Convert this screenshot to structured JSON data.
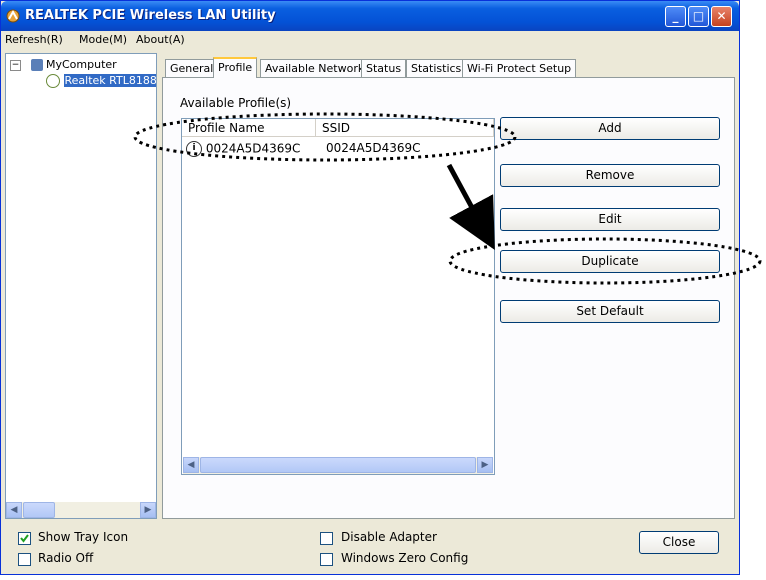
{
  "window": {
    "title": "REALTEK PCIE Wireless LAN Utility",
    "minimize_glyph": "_",
    "maximize_glyph": "□",
    "close_glyph": "✕"
  },
  "menu": {
    "refresh": "Refresh(R)",
    "mode": "Mode(M)",
    "about": "About(A)"
  },
  "tree": {
    "root": "MyComputer",
    "adapter": "Realtek RTL8188"
  },
  "tabs": [
    "General",
    "Profile",
    "Available Network",
    "Status",
    "Statistics",
    "Wi-Fi Protect Setup"
  ],
  "active_tab": "Profile",
  "profile": {
    "list_label": "Available Profile(s)",
    "columns": [
      "Profile Name",
      "SSID"
    ],
    "rows": [
      {
        "profile_name": "0024A5D4369C",
        "ssid": "0024A5D4369C"
      }
    ]
  },
  "buttons": {
    "add": "Add",
    "remove": "Remove",
    "edit": "Edit",
    "duplicate": "Duplicate",
    "set_default": "Set Default",
    "close": "Close"
  },
  "options": {
    "show_tray_icon": {
      "label": "Show Tray Icon",
      "checked": true
    },
    "radio_off": {
      "label": "Radio Off",
      "checked": false
    },
    "disable_adapter": {
      "label": "Disable Adapter",
      "checked": false
    },
    "windows_zero_config": {
      "label": "Windows Zero Config",
      "checked": false
    }
  },
  "colors": {
    "title_bar": "#0452d6",
    "accent_tab": "#ffc83c",
    "annotation": "#000000"
  }
}
